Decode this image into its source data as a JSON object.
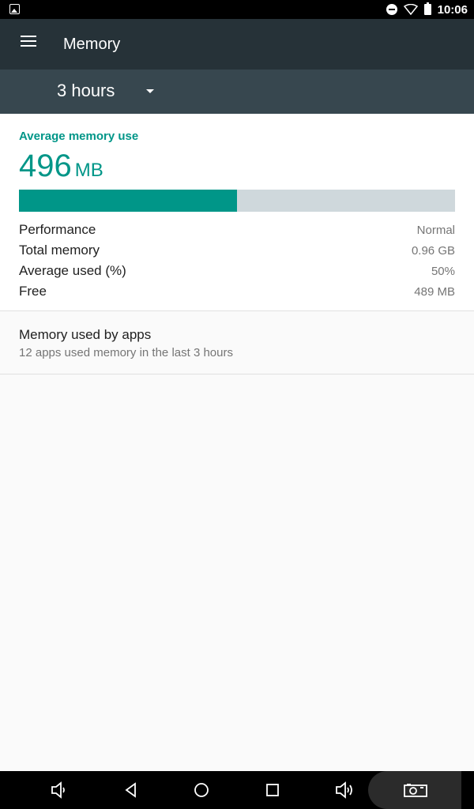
{
  "status_bar": {
    "time": "10:06",
    "icons": [
      "image-icon",
      "do-not-disturb-icon",
      "wifi-icon",
      "battery-icon"
    ]
  },
  "app_bar": {
    "title": "Memory",
    "menu_icon": "menu-icon"
  },
  "spinner": {
    "selected": "3 hours",
    "icon": "dropdown-arrow-icon"
  },
  "summary": {
    "label": "Average memory use",
    "value": "496",
    "unit": "MB",
    "usage_fraction": 0.5,
    "accent_color": "#009688",
    "track_color": "#cfd8dc"
  },
  "stats": [
    {
      "label": "Performance",
      "value": "Normal"
    },
    {
      "label": "Total memory",
      "value": "0.96 GB"
    },
    {
      "label": "Average used (%)",
      "value": "50%"
    },
    {
      "label": "Free",
      "value": "489 MB"
    }
  ],
  "apps": {
    "title": "Memory used by apps",
    "subtitle": "12 apps used memory in the last 3 hours"
  },
  "nav_bar": {
    "buttons": [
      "volume-down-icon",
      "back-icon",
      "home-icon",
      "recents-icon",
      "volume-up-icon",
      "screenshot-icon"
    ]
  },
  "colors": {
    "app_bar": "#263238",
    "spinner_bar": "#37474f",
    "accent": "#009688"
  }
}
